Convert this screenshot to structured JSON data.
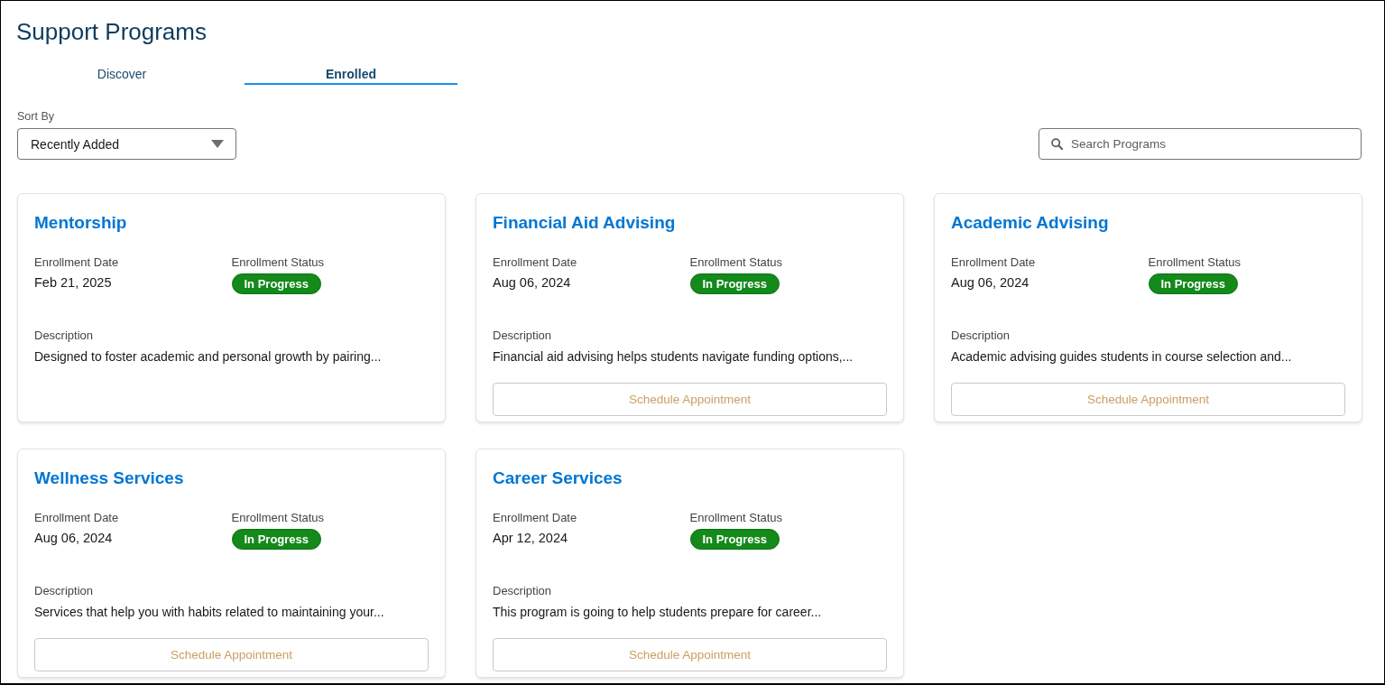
{
  "page": {
    "title": "Support Programs"
  },
  "tabs": [
    {
      "label": "Discover",
      "selected": false
    },
    {
      "label": "Enrolled",
      "selected": true
    }
  ],
  "sort": {
    "label": "Sort By",
    "value": "Recently Added"
  },
  "search": {
    "placeholder": "Search Programs"
  },
  "programs": [
    {
      "name": "Mentorship",
      "date_label": "Enrollment Date",
      "date": "Feb 21, 2025",
      "status_label": "Enrollment Status",
      "status": "In Progress",
      "description_label": "Description",
      "description": "Designed to foster academic and personal growth by pairing..."
    },
    {
      "name": "Financial Aid Advising",
      "date_label": "Enrollment Date",
      "date": "Aug 06, 2024",
      "status_label": "Enrollment Status",
      "status": "In Progress",
      "description_label": "Description",
      "description": "Financial aid advising helps students navigate funding options,...",
      "action": "Schedule Appointment"
    },
    {
      "name": "Academic Advising",
      "date_label": "Enrollment Date",
      "date": "Aug 06, 2024",
      "status_label": "Enrollment Status",
      "status": "In Progress",
      "description_label": "Description",
      "description": "Academic advising guides students in course selection and...",
      "action": "Schedule Appointment"
    },
    {
      "name": "Wellness Services",
      "date_label": "Enrollment Date",
      "date": "Aug 06, 2024",
      "status_label": "Enrollment Status",
      "status": "In Progress",
      "description_label": "Description",
      "description": "Services that help you with habits related to maintaining your...",
      "action": "Schedule Appointment"
    },
    {
      "name": "Career Services",
      "date_label": "Enrollment Date",
      "date": "Apr 12, 2024",
      "status_label": "Enrollment Status",
      "status": "In Progress",
      "description_label": "Description",
      "description": "This program is going to help students prepare for career...",
      "action": "Schedule Appointment"
    }
  ]
}
